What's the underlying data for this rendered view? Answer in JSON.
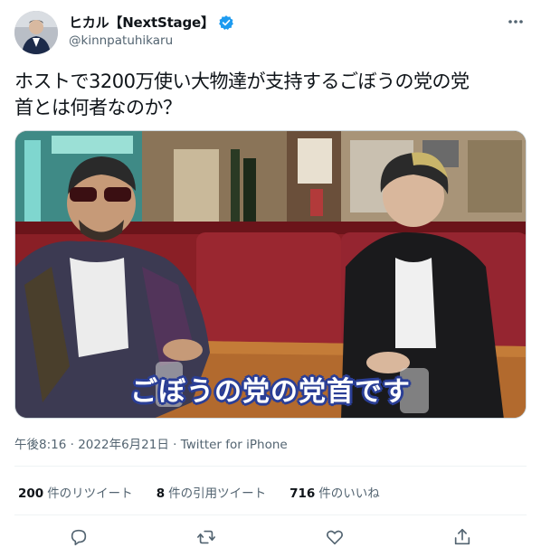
{
  "author": {
    "display_name": "ヒカル【NextStage】",
    "handle": "@kinnpatuhikaru",
    "verified": true
  },
  "tweet": {
    "text_line1": "ホストで3200万使い大物達が支持するごぼうの党の党",
    "text_line2": "首とは何者なのか？",
    "media_caption": "ごぼうの党の党首です",
    "time": "午後8:16",
    "date": "2022年6月21日",
    "separator": "·",
    "source": "Twitter for iPhone"
  },
  "stats": {
    "retweets_count": "200",
    "retweets_label": "件のリツイート",
    "quotes_count": "8",
    "quotes_label": "件の引用ツイート",
    "likes_count": "716",
    "likes_label": "件のいいね"
  },
  "icons": {
    "more": "more-icon",
    "reply": "reply-icon",
    "retweet": "retweet-icon",
    "like": "heart-icon",
    "share": "share-icon",
    "verified": "verified-badge-icon"
  },
  "colors": {
    "verified_blue": "#1d9bf0",
    "caption_outline": "#2a3e96",
    "secondary_text": "#536471"
  }
}
